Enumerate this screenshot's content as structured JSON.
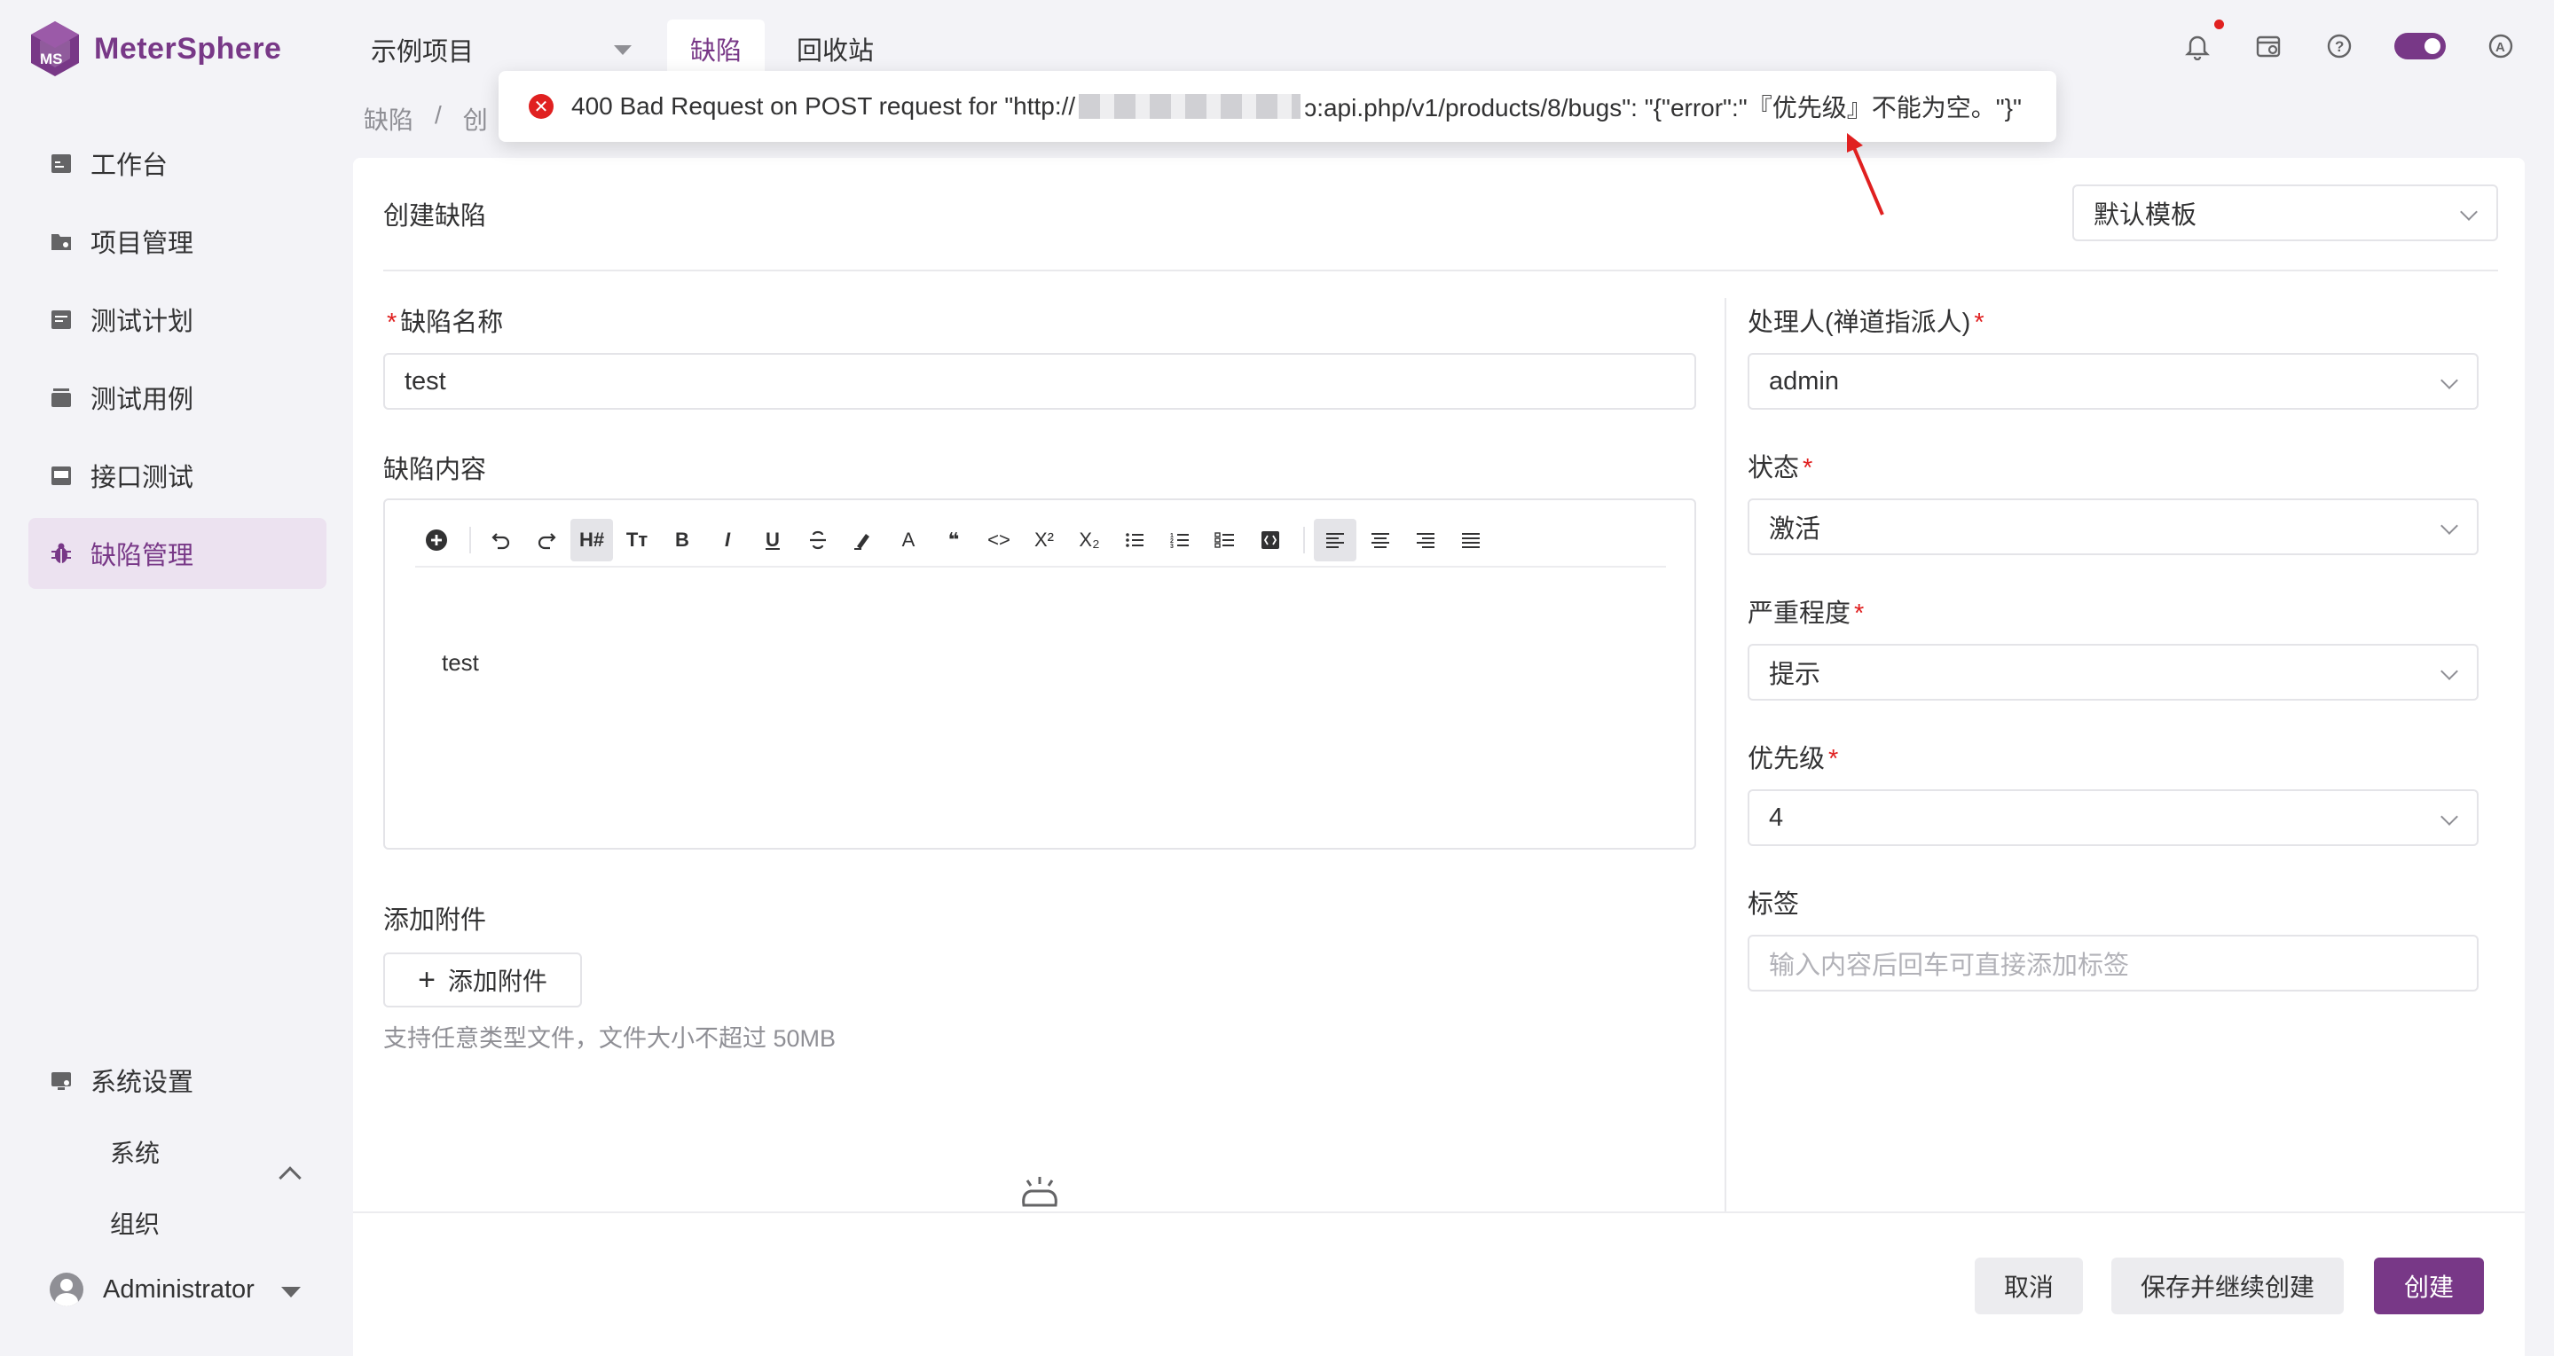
{
  "app": {
    "name": "MeterSphere",
    "project": "示例项目"
  },
  "top_tabs": [
    {
      "label": "缺陷"
    },
    {
      "label": "回收站"
    }
  ],
  "breadcrumb": {
    "root": "缺陷",
    "sep": "/",
    "current": "创"
  },
  "sidebar": {
    "items": [
      {
        "label": "工作台"
      },
      {
        "label": "项目管理"
      },
      {
        "label": "测试计划"
      },
      {
        "label": "测试用例"
      },
      {
        "label": "接口测试"
      },
      {
        "label": "缺陷管理"
      }
    ],
    "settings": {
      "label": "系统设置",
      "children": [
        {
          "label": "系统"
        },
        {
          "label": "组织"
        }
      ]
    },
    "user": {
      "name": "Administrator"
    }
  },
  "form": {
    "title": "创建缺陷",
    "template": "默认模板",
    "name_label": "缺陷名称",
    "name_value": "test",
    "content_label": "缺陷内容",
    "content_text": "test",
    "attach_label": "添加附件",
    "attach_button": "添加附件",
    "attach_hint": "支持任意类型文件，文件大小不超过 50MB",
    "assignee_label": "处理人(禅道指派人)",
    "assignee_value": "admin",
    "status_label": "状态",
    "status_value": "激活",
    "severity_label": "严重程度",
    "severity_value": "提示",
    "priority_label": "优先级",
    "priority_value": "4",
    "tags_label": "标签",
    "tags_placeholder": "输入内容后回车可直接添加标签"
  },
  "toolbar": {
    "buttons": [
      "plus-circle-icon",
      "undo-icon",
      "redo-icon",
      "heading-icon",
      "font-size-icon",
      "bold-icon",
      "italic-icon",
      "underline-icon",
      "strikethrough-icon",
      "highlight-icon",
      "font-color-icon",
      "quote-icon",
      "code-icon",
      "superscript-icon",
      "subscript-icon",
      "bullet-list-icon",
      "ordered-list-icon",
      "task-list-icon",
      "code-block-icon",
      "align-left-icon",
      "align-center-icon",
      "align-right-icon",
      "align-justify-icon"
    ],
    "heading_text": "H#",
    "fontsize_text": "Tт",
    "bold_text": "B",
    "italic_text": "I",
    "underline_text": "U",
    "font_color_text": "A",
    "quote_text": "❝",
    "code_text": "<>",
    "sup_text": "X²",
    "sub_text": "X₂"
  },
  "actions": {
    "cancel": "取消",
    "save_continue": "保存并继续创建",
    "create": "创建"
  },
  "toast": {
    "prefix": "400 Bad Request on POST request for \"http://",
    "suffix": "ɔ:api.php/v1/products/8/bugs\": \"{\"error\":\"『优先级』不能为空。\"}\""
  },
  "colors": {
    "brand": "#783887",
    "error": "#e02020"
  }
}
